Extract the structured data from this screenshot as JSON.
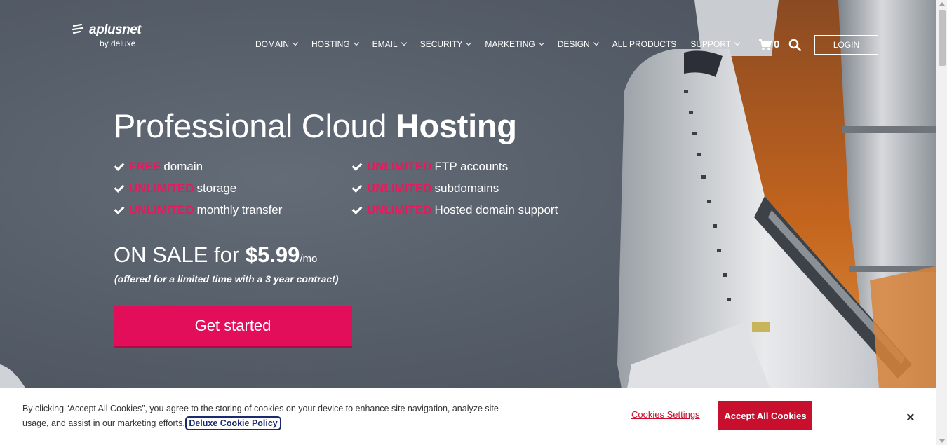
{
  "brand": {
    "name": "aplusnet",
    "sub": "by deluxe"
  },
  "nav": {
    "items": [
      {
        "label": "DOMAIN",
        "has_dropdown": true
      },
      {
        "label": "HOSTING",
        "has_dropdown": true
      },
      {
        "label": "EMAIL",
        "has_dropdown": true
      },
      {
        "label": "SECURITY",
        "has_dropdown": true
      },
      {
        "label": "MARKETING",
        "has_dropdown": true
      },
      {
        "label": "DESIGN",
        "has_dropdown": true
      },
      {
        "label": "ALL PRODUCTS",
        "has_dropdown": false
      },
      {
        "label": "SUPPORT",
        "has_dropdown": true
      }
    ],
    "cart_count": "0",
    "login_label": "LOGIN"
  },
  "hero": {
    "headline_light": "Professional Cloud",
    "headline_bold": "Hosting",
    "features": [
      {
        "highlight": "FREE",
        "text": "domain"
      },
      {
        "highlight": "UNLIMITED",
        "text": "storage"
      },
      {
        "highlight": "UNLIMITED",
        "text": "monthly transfer"
      },
      {
        "highlight": "UNLIMITED",
        "text": "FTP accounts"
      },
      {
        "highlight": "UNLIMITED",
        "text": "subdomains"
      },
      {
        "highlight": "UNLIMITED",
        "text": "Hosted domain support"
      }
    ],
    "sale_prefix": "ON SALE for",
    "price": "$5.99",
    "per": "/mo",
    "sale_note": "(offered for a limited time with a 3 year contract)",
    "cta_label": "Get started"
  },
  "cookie": {
    "text": "By clicking “Accept All Cookies”, you agree to the storing of cookies on your device to enhance site navigation, analyze site usage, and assist in our marketing efforts.",
    "policy_link": "Deluxe Cookie Policy",
    "settings_label": "Cookies Settings",
    "accept_label": "Accept All Cookies",
    "close_label": "×"
  },
  "colors": {
    "accent": "#e20e59",
    "highlight": "#e8195c",
    "cookie_accent": "#c8102e"
  },
  "icons": {
    "cart": "cart-icon",
    "search": "search-icon",
    "check": "check-icon",
    "chevron": "chevron-down-icon",
    "close": "close-icon",
    "logo": "logo-icon"
  }
}
